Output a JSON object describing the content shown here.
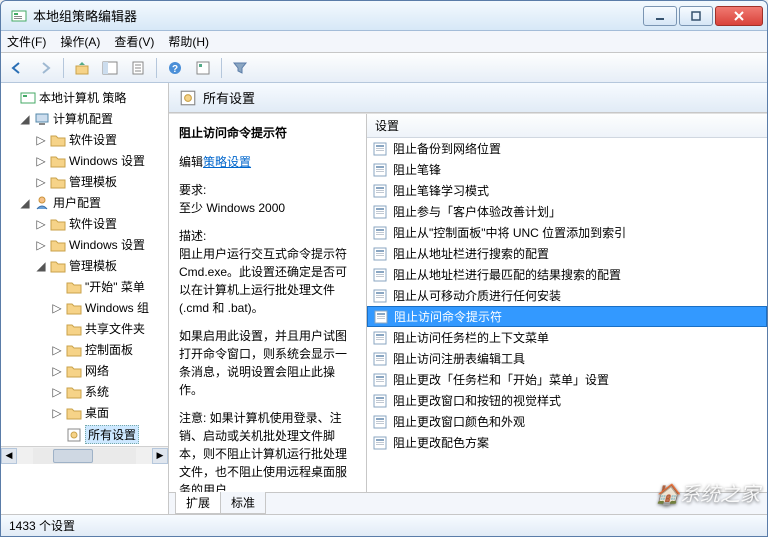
{
  "window": {
    "title": "本地组策略编辑器"
  },
  "menu": {
    "file": "文件(F)",
    "action": "操作(A)",
    "view": "查看(V)",
    "help": "帮助(H)"
  },
  "tree": {
    "root": "本地计算机 策略",
    "computer_config": "计算机配置",
    "software_settings": "软件设置",
    "windows_settings": "Windows 设置",
    "admin_templates": "管理模板",
    "user_config": "用户配置",
    "start_menu": "\"开始\" 菜单",
    "windows_components": "Windows 组",
    "shared_folders": "共享文件夹",
    "control_panel": "控制面板",
    "network": "网络",
    "system": "系统",
    "desktop": "桌面",
    "all_settings": "所有设置"
  },
  "header": {
    "title": "所有设置"
  },
  "desc": {
    "title": "阻止访问命令提示符",
    "edit_prefix": "编辑",
    "edit_link": "策略设置",
    "req_label": "要求:",
    "req_value": "至少 Windows 2000",
    "d_label": "描述:",
    "d_p1": "阻止用户运行交互式命令提示符 Cmd.exe。此设置还确定是否可以在计算机上运行批处理文件(.cmd 和 .bat)。",
    "d_p2": "如果启用此设置，并且用户试图打开命令窗口，则系统会显示一条消息，说明设置会阻止此操作。",
    "d_p3": "注意: 如果计算机使用登录、注销、启动或关机批处理文件脚本，则不阻止计算机运行批处理文件，也不阻止使用远程桌面服务的用户"
  },
  "list": {
    "col": "设置",
    "items": [
      "阻止备份到网络位置",
      "阻止笔锋",
      "阻止笔锋学习模式",
      "阻止参与「客户体验改善计划」",
      "阻止从\"控制面板\"中将 UNC 位置添加到索引",
      "阻止从地址栏进行搜索的配置",
      "阻止从地址栏进行最匹配的结果搜索的配置",
      "阻止从可移动介质进行任何安装",
      "阻止访问命令提示符",
      "阻止访问任务栏的上下文菜单",
      "阻止访问注册表编辑工具",
      "阻止更改「任务栏和「开始」菜单」设置",
      "阻止更改窗口和按钮的视觉样式",
      "阻止更改窗口颜色和外观",
      "阻止更改配色方案"
    ],
    "selected_index": 8
  },
  "tabs": {
    "extended": "扩展",
    "standard": "标准"
  },
  "status": {
    "text": "1433 个设置"
  },
  "watermark": "系统之家"
}
